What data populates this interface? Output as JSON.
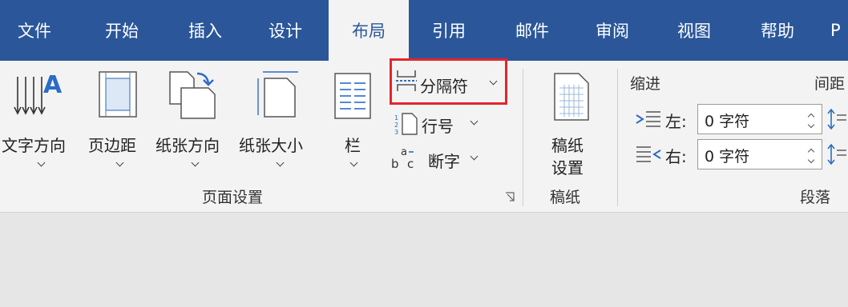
{
  "tabs": [
    {
      "label": "文件"
    },
    {
      "label": "开始"
    },
    {
      "label": "插入"
    },
    {
      "label": "设计"
    },
    {
      "label": "布局",
      "active": true
    },
    {
      "label": "引用"
    },
    {
      "label": "邮件"
    },
    {
      "label": "审阅"
    },
    {
      "label": "视图"
    },
    {
      "label": "帮助"
    },
    {
      "label": "P"
    }
  ],
  "page_setup": {
    "text_direction": "文字方向",
    "margins": "页边距",
    "orientation": "纸张方向",
    "size": "纸张大小",
    "columns": "栏",
    "breaks": "分隔符",
    "line_numbers": "行号",
    "hyphenation": "断字",
    "group_label": "页面设置"
  },
  "manuscript": {
    "button_line1": "稿纸",
    "button_line2": "设置",
    "group_label": "稿纸"
  },
  "paragraph": {
    "indent_heading": "缩进",
    "spacing_heading": "间距",
    "left_label": "左:",
    "left_value": "0 字符",
    "right_label": "右:",
    "right_value": "0 字符",
    "group_label": "段落"
  },
  "colors": {
    "accent": "#2b579a",
    "highlight": "#e3262b"
  }
}
